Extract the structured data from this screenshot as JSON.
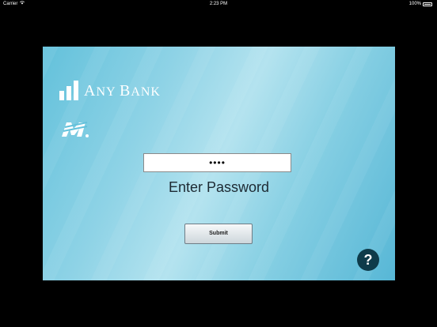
{
  "status_bar": {
    "carrier": "Carrier",
    "time": "2:23 PM",
    "battery": "100%"
  },
  "brand": {
    "name_first": "A",
    "name_first_rest": "NY",
    "name_second": "B",
    "name_second_rest": "ANK"
  },
  "login": {
    "password_value": "••••",
    "prompt": "Enter Password",
    "submit_label": "Submit",
    "help_label": "?"
  },
  "colors": {
    "panel_gradient_start": "#63c1db",
    "panel_gradient_mid": "#b4e3ef",
    "help_button": "#0e3b4a"
  }
}
